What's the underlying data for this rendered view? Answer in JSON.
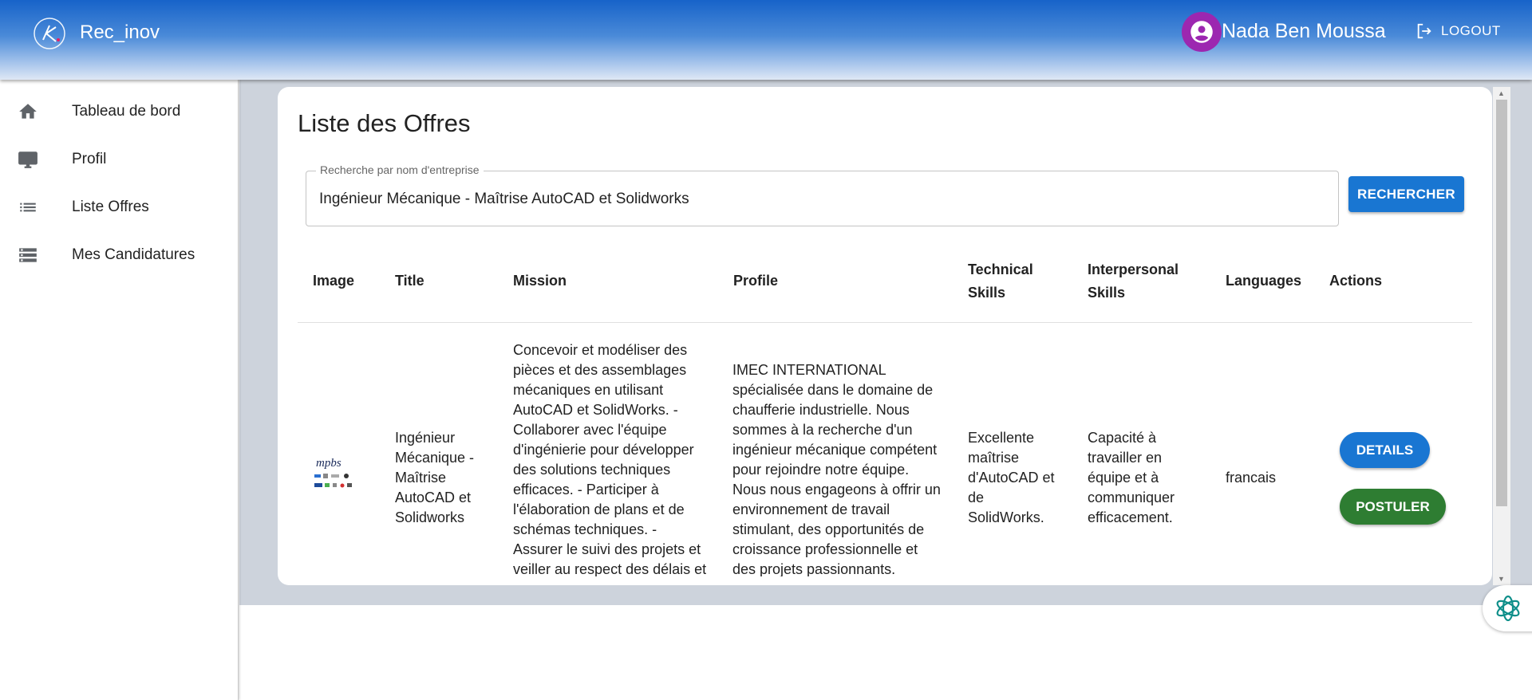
{
  "header": {
    "app_title": "Rec_inov",
    "user_name": "Nada Ben Moussa",
    "logout_label": "LOGOUT"
  },
  "sidebar": {
    "items": [
      {
        "label": "Tableau de bord",
        "icon": "home-icon"
      },
      {
        "label": "Profil",
        "icon": "monitor-icon"
      },
      {
        "label": "Liste Offres",
        "icon": "list-icon"
      },
      {
        "label": "Mes Candidatures",
        "icon": "storage-icon"
      }
    ]
  },
  "main": {
    "title": "Liste des Offres",
    "search": {
      "label": "Recherche par nom d'entreprise",
      "value": "Ingénieur Mécanique - Maîtrise AutoCAD et Solidworks",
      "button_label": "RECHERCHER"
    },
    "table": {
      "headers": [
        "Image",
        "Title",
        "Mission",
        "Profile",
        "Technical Skills",
        "Interpersonal Skills",
        "Languages",
        "Actions"
      ],
      "rows": [
        {
          "image_logo_text": "mpbs",
          "title": "Ingénieur Mécanique - Maîtrise AutoCAD et Solidworks",
          "mission": "Concevoir et modéliser des pièces et des assemblages mécaniques en utilisant AutoCAD et SolidWorks. - Collaborer avec l'équipe d'ingénierie pour développer des solutions techniques efficaces. - Participer à l'élaboration de plans et de schémas techniques. - Assurer le suivi des projets et veiller au respect des délais et des normes de",
          "profile": "IMEC INTERNATIONAL spécialisée dans le domaine de chaufferie industrielle. Nous sommes à la recherche d'un ingénieur mécanique compétent pour rejoindre notre équipe. Nous nous engageons à offrir un environnement de travail stimulant, des opportunités de croissance professionnelle et des projets passionnants.",
          "technical_skills": "Excellente maîtrise d'AutoCAD et de SolidWorks.",
          "interpersonal_skills": "Capacité à travailler en équipe et à communiquer efficacement.",
          "languages": "francais",
          "actions": {
            "details": "DETAILS",
            "apply": "POSTULER"
          }
        }
      ]
    }
  },
  "colors": {
    "primary": "#1976d2",
    "success": "#2e7d32",
    "avatar": "#9c27b0",
    "header_top": "#1763c9"
  }
}
